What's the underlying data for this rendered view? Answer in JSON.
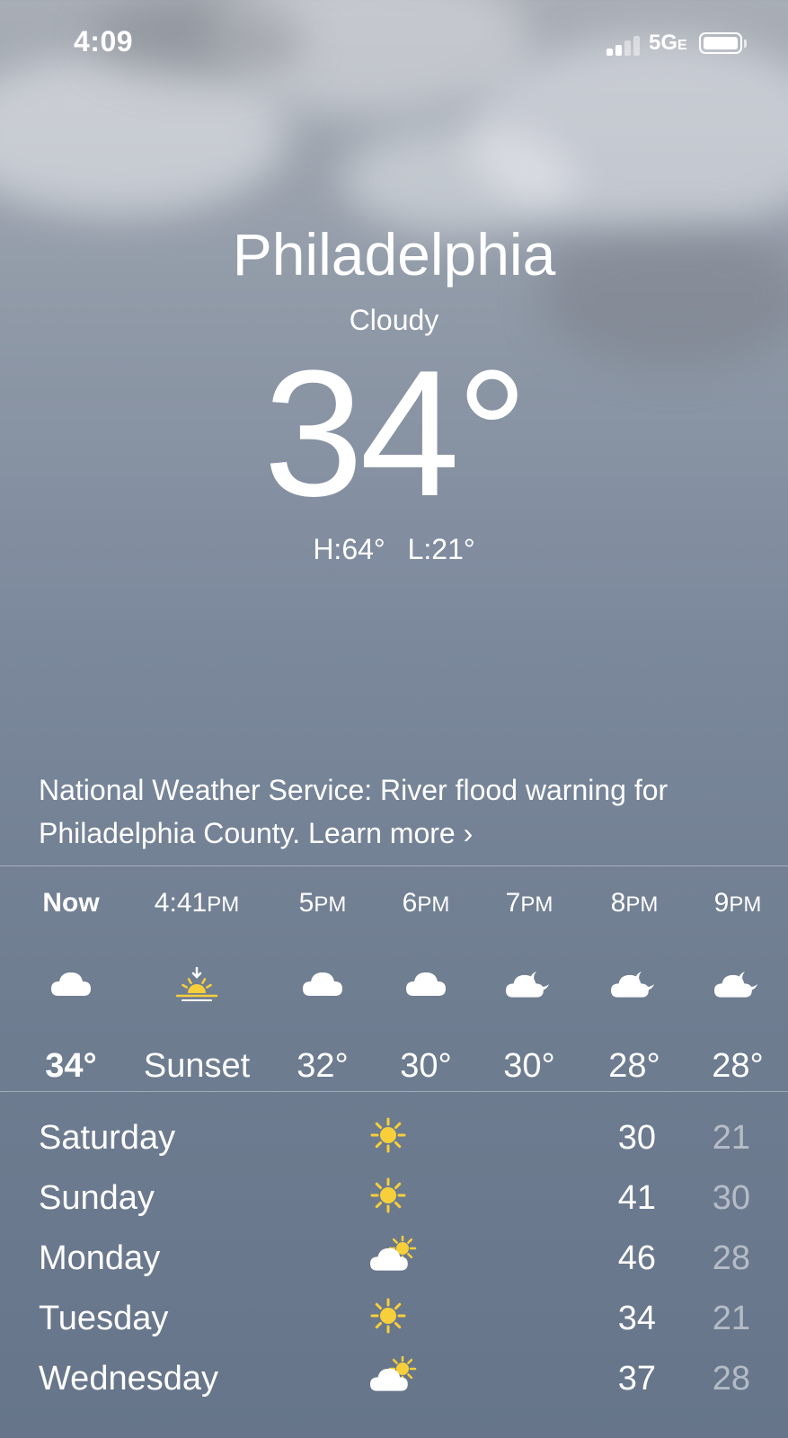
{
  "status_bar": {
    "time": "4:09",
    "network": "5G",
    "network_suffix": "E"
  },
  "location": {
    "city": "Philadelphia",
    "condition": "Cloudy",
    "temperature": "34°",
    "high": "H:64°",
    "low": "L:21°"
  },
  "alert": {
    "text": "National Weather Service: River flood warning for Philadelphia County.",
    "link": "Learn more",
    "chevron": "›"
  },
  "hourly": [
    {
      "time": "Now",
      "suffix": "",
      "icon": "cloud-icon",
      "temp": "34°",
      "bold": true
    },
    {
      "time": "4:41",
      "suffix": "PM",
      "icon": "sunset-icon",
      "temp": "Sunset",
      "bold": false
    },
    {
      "time": "5",
      "suffix": "PM",
      "icon": "cloud-icon",
      "temp": "32°",
      "bold": false
    },
    {
      "time": "6",
      "suffix": "PM",
      "icon": "cloud-icon",
      "temp": "30°",
      "bold": false
    },
    {
      "time": "7",
      "suffix": "PM",
      "icon": "cloud-moon-icon",
      "temp": "30°",
      "bold": false
    },
    {
      "time": "8",
      "suffix": "PM",
      "icon": "cloud-moon-icon",
      "temp": "28°",
      "bold": false
    },
    {
      "time": "9",
      "suffix": "PM",
      "icon": "cloud-moon-icon",
      "temp": "28°",
      "bold": false
    }
  ],
  "daily": [
    {
      "day": "Saturday",
      "icon": "sun-icon",
      "high": "30",
      "low": "21"
    },
    {
      "day": "Sunday",
      "icon": "sun-icon",
      "high": "41",
      "low": "30"
    },
    {
      "day": "Monday",
      "icon": "partly-cloudy-icon",
      "high": "46",
      "low": "28"
    },
    {
      "day": "Tuesday",
      "icon": "sun-icon",
      "high": "34",
      "low": "21"
    },
    {
      "day": "Wednesday",
      "icon": "partly-cloudy-icon",
      "high": "37",
      "low": "28"
    }
  ],
  "colors": {
    "sun": "#f6cf3a",
    "text": "#ffffff",
    "low_temp": "rgba(255,255,255,0.5)"
  }
}
